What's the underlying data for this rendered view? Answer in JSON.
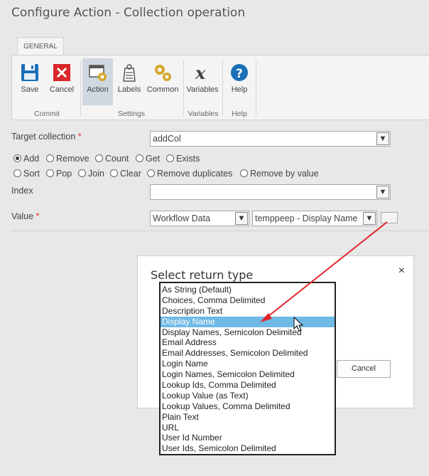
{
  "window": {
    "title": "Configure Action - Collection operation"
  },
  "ribbon": {
    "tab": "GENERAL",
    "buttons": {
      "save": "Save",
      "cancel": "Cancel",
      "action": "Action",
      "labels": "Labels",
      "common": "Common",
      "variables": "Variables",
      "help": "Help"
    },
    "groups": {
      "commit": "Commit",
      "settings": "Settings",
      "variables": "Variables",
      "help": "Help"
    }
  },
  "form": {
    "target_collection": {
      "label": "Target collection",
      "required": "*",
      "value": "addCol"
    },
    "operations": {
      "row1": [
        "Add",
        "Remove",
        "Count",
        "Get",
        "Exists"
      ],
      "row2": [
        "Sort",
        "Pop",
        "Join",
        "Clear",
        "Remove duplicates",
        "Remove by value"
      ],
      "selected": "Add"
    },
    "index": {
      "label": "Index",
      "value": ""
    },
    "value": {
      "label": "Value",
      "required": "*",
      "source": "Workflow Data",
      "field": "temppeep - Display Name"
    }
  },
  "dialog": {
    "title": "Select return type",
    "close": "×",
    "cancel": "Cancel",
    "options": [
      "As String (Default)",
      "Choices, Comma Delimited",
      "Description Text",
      "Display Name",
      "Display Names, Semicolon Delimited",
      "Email Address",
      "Email Addresses, Semicolon Delimited",
      "Login Name",
      "Login Names, Semicolon Delimited",
      "Lookup Ids, Comma Delimited",
      "Lookup Value (as Text)",
      "Lookup Values, Comma Delimited",
      "Plain Text",
      "URL",
      "User Id Number",
      "User Ids, Semicolon Delimited"
    ],
    "highlighted": "Display Name"
  },
  "colors": {
    "highlight": "#6fb9e5",
    "arrow": "#e0262b",
    "save_icon": "#1b6fb8",
    "cancel_icon": "#d9262b",
    "help_icon": "#1b6fb8"
  }
}
